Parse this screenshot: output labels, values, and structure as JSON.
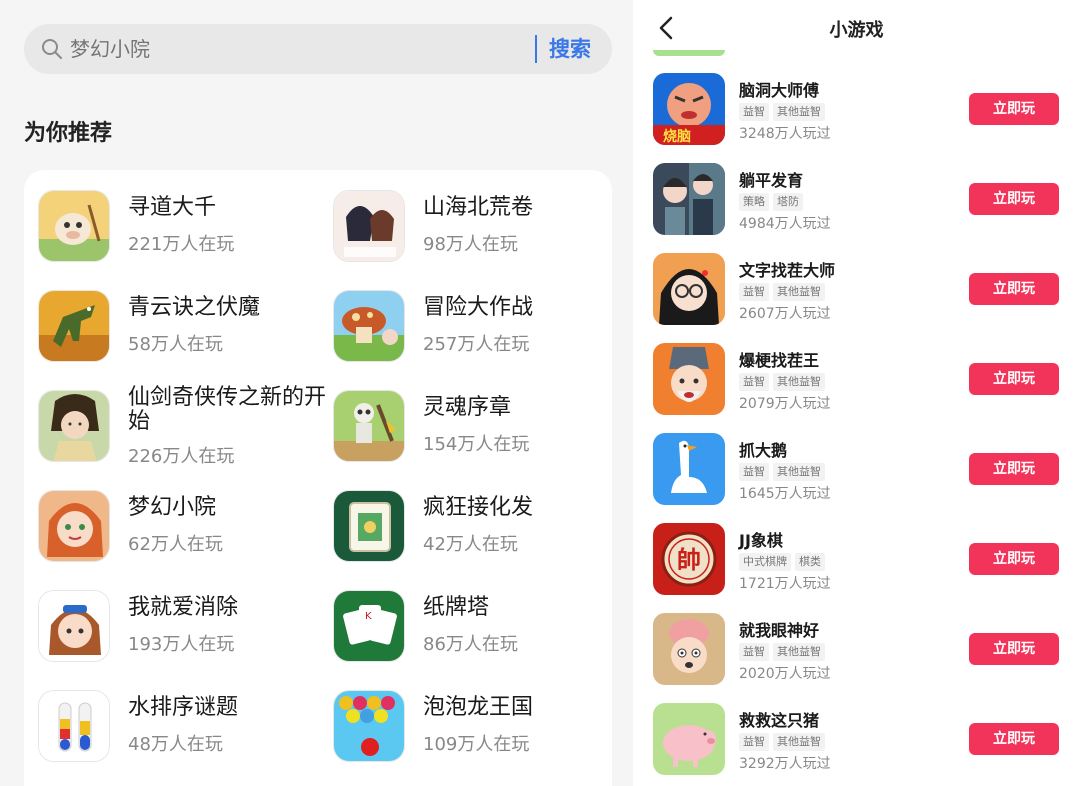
{
  "search": {
    "placeholder": "梦幻小院",
    "button_label": "搜索"
  },
  "recommend": {
    "title": "为你推荐",
    "items": [
      {
        "name": "寻道大千",
        "players": "221万人在玩"
      },
      {
        "name": "山海北荒卷",
        "players": "98万人在玩"
      },
      {
        "name": "青云诀之伏魔",
        "players": "58万人在玩"
      },
      {
        "name": "冒险大作战",
        "players": "257万人在玩"
      },
      {
        "name": "仙剑奇侠传之新的开始",
        "players": "226万人在玩"
      },
      {
        "name": "灵魂序章",
        "players": "154万人在玩"
      },
      {
        "name": "梦幻小院",
        "players": "62万人在玩"
      },
      {
        "name": "疯狂接化发",
        "players": "42万人在玩"
      },
      {
        "name": "我就爱消除",
        "players": "193万人在玩"
      },
      {
        "name": "纸牌塔",
        "players": "86万人在玩"
      },
      {
        "name": "水排序谜题",
        "players": "48万人在玩"
      },
      {
        "name": "泡泡龙王国",
        "players": "109万人在玩"
      }
    ]
  },
  "mini_games": {
    "title": "小游戏",
    "play_label": "立即玩",
    "games": [
      {
        "name": "脑洞大师傅",
        "tags": [
          "益智",
          "其他益智"
        ],
        "plays": "3248万人玩过",
        "icon": "brain-master-icon",
        "icon_text": "烧脑"
      },
      {
        "name": "躺平发育",
        "tags": [
          "策略",
          "塔防"
        ],
        "plays": "4984万人玩过",
        "icon": "lie-flat-icon"
      },
      {
        "name": "文字找茬大师",
        "tags": [
          "益智",
          "其他益智"
        ],
        "plays": "2607万人玩过",
        "icon": "word-spot-icon"
      },
      {
        "name": "爆梗找茬王",
        "tags": [
          "益智",
          "其他益智"
        ],
        "plays": "2079万人玩过",
        "icon": "meme-spot-icon"
      },
      {
        "name": "抓大鹅",
        "tags": [
          "益智",
          "其他益智"
        ],
        "plays": "1645万人玩过",
        "icon": "goose-icon"
      },
      {
        "name": "JJ象棋",
        "tags": [
          "中式棋牌",
          "棋类"
        ],
        "plays": "1721万人玩过",
        "icon": "chess-icon",
        "icon_text": "帥"
      },
      {
        "name": "就我眼神好",
        "tags": [
          "益智",
          "其他益智"
        ],
        "plays": "2020万人玩过",
        "icon": "sharp-eye-icon"
      },
      {
        "name": "救救这只猪",
        "tags": [
          "益智",
          "其他益智"
        ],
        "plays": "3292万人玩过",
        "icon": "pig-icon"
      }
    ]
  },
  "colors": {
    "accent_blue": "#3b78e7",
    "play_red": "#f2335a"
  }
}
